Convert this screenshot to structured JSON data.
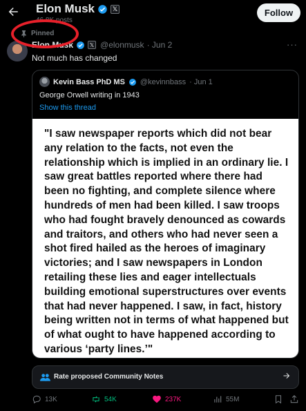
{
  "header": {
    "name": "Elon Musk",
    "posts_count": "46.8K posts",
    "follow_label": "Follow"
  },
  "pinned_label": "Pinned",
  "tweet": {
    "author_name": "Elon Musk",
    "author_handle": "@elonmusk",
    "date": "· Jun 2",
    "text": "Not much has changed"
  },
  "quoted": {
    "author_name": "Kevin Bass PhD MS",
    "author_handle": "@kevinnbass",
    "date": "· Jun 1",
    "text": "George Orwell writing in 1943",
    "show_thread": "Show this thread",
    "image_quote": "\"I saw newspaper reports which did not bear any relation to the facts, not even the relationship which is implied in an ordinary lie. I saw great battles reported where there had been no fighting, and complete silence where hundreds of men had been killed. I saw troops who had fought bravely denounced as cowards and traitors, and others who had never seen a shot fired hailed as the heroes of imaginary victories; and I saw newspapers in London retailing these lies and eager intellectuals building emotional superstructures over events that had never happened. I saw, in fact, history being written not in terms of what happened but of what ought to have happened according to various ‘party lines.’\""
  },
  "community_notes": {
    "label": "Rate proposed Community Notes"
  },
  "actions": {
    "replies": "13K",
    "reposts": "54K",
    "likes": "237K",
    "views": "55M"
  },
  "colors": {
    "accent": "#1d9bf0",
    "repost": "#00ba7c",
    "like": "#f91880",
    "annotation": "#e8202a"
  }
}
